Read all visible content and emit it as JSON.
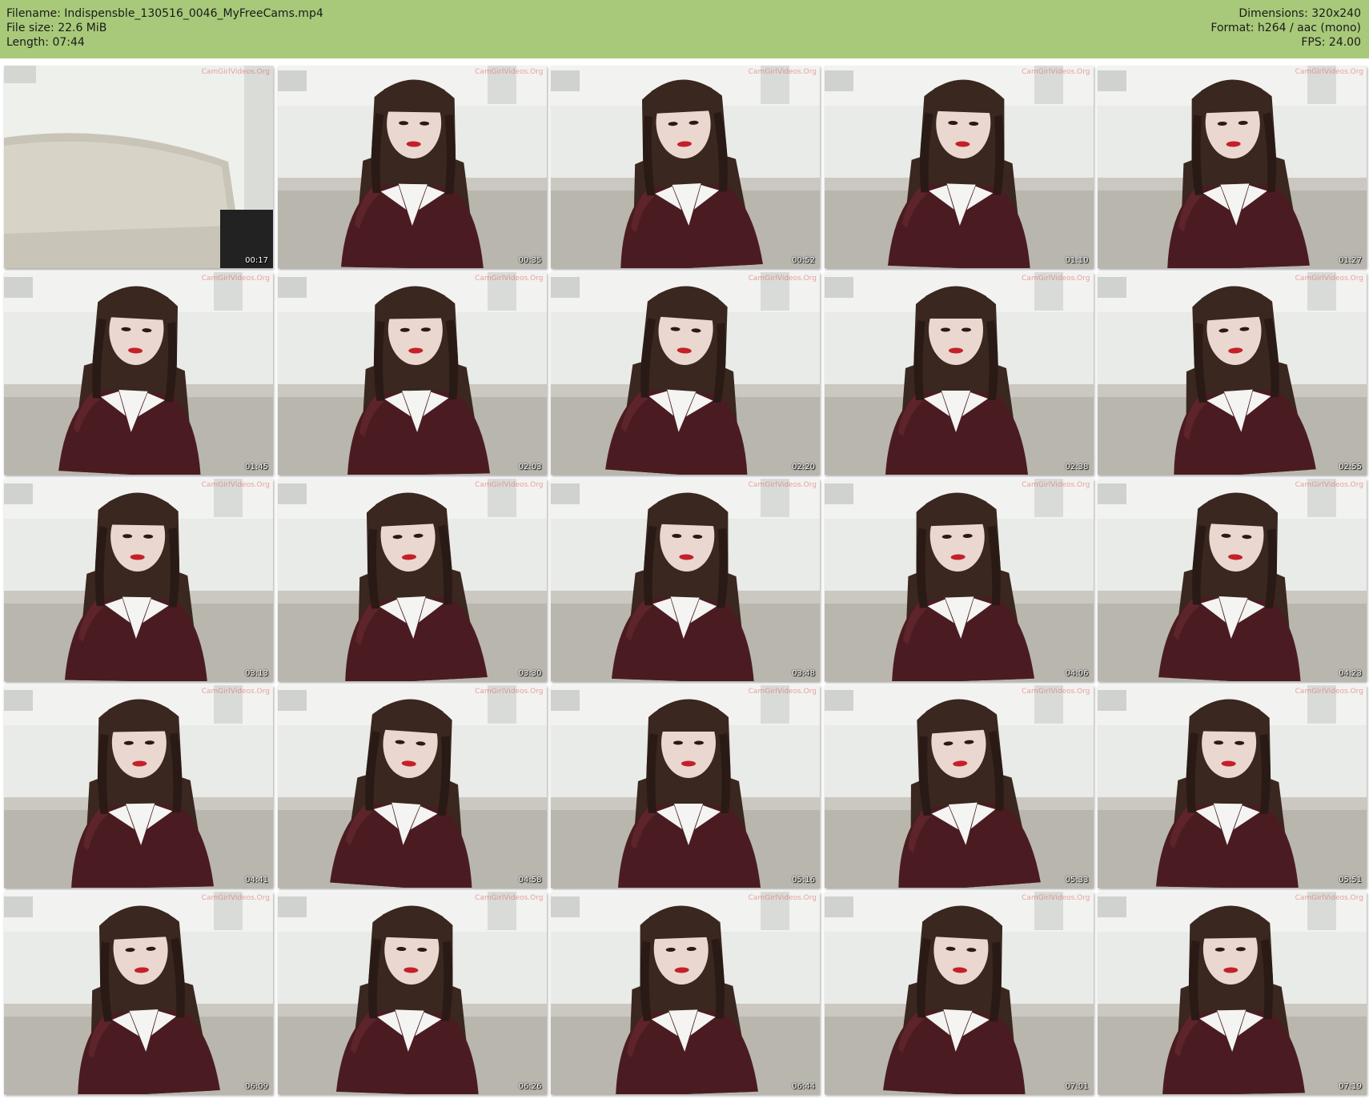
{
  "header": {
    "filename_line": "Filename: Indispensble_130516_0046_MyFreeCams.mp4",
    "filesize_line": "File size: 22.6 MiB",
    "length_line": "Length: 07:44",
    "dimensions_line": "Dimensions: 320x240",
    "format_line": "Format: h264 / aac (mono)",
    "fps_line": "FPS: 24.00"
  },
  "colors": {
    "header_bg": "#a8c97a",
    "wall": "#e8ebe7",
    "sofa": "#b9b6ae",
    "hair": "#3a2720",
    "dress": "#4a1c22",
    "collar": "#f4f4f2",
    "lips": "#c4202a"
  },
  "watermark_text": "CamGirlVideos.Org",
  "thumbnails": [
    {
      "time": "00:17",
      "scene": "empty"
    },
    {
      "time": "00:35",
      "scene": "person"
    },
    {
      "time": "00:52",
      "scene": "person"
    },
    {
      "time": "01:10",
      "scene": "person"
    },
    {
      "time": "01:27",
      "scene": "person"
    },
    {
      "time": "01:45",
      "scene": "person"
    },
    {
      "time": "02:03",
      "scene": "person"
    },
    {
      "time": "02:20",
      "scene": "person"
    },
    {
      "time": "02:38",
      "scene": "person"
    },
    {
      "time": "02:55",
      "scene": "person"
    },
    {
      "time": "03:13",
      "scene": "person"
    },
    {
      "time": "03:30",
      "scene": "person"
    },
    {
      "time": "03:48",
      "scene": "person"
    },
    {
      "time": "04:06",
      "scene": "person"
    },
    {
      "time": "04:23",
      "scene": "person"
    },
    {
      "time": "04:41",
      "scene": "person"
    },
    {
      "time": "04:58",
      "scene": "person"
    },
    {
      "time": "05:16",
      "scene": "person"
    },
    {
      "time": "05:33",
      "scene": "person"
    },
    {
      "time": "05:51",
      "scene": "person"
    },
    {
      "time": "06:09",
      "scene": "person"
    },
    {
      "time": "06:26",
      "scene": "person"
    },
    {
      "time": "06:44",
      "scene": "person"
    },
    {
      "time": "07:01",
      "scene": "person"
    },
    {
      "time": "07:19",
      "scene": "person"
    }
  ]
}
